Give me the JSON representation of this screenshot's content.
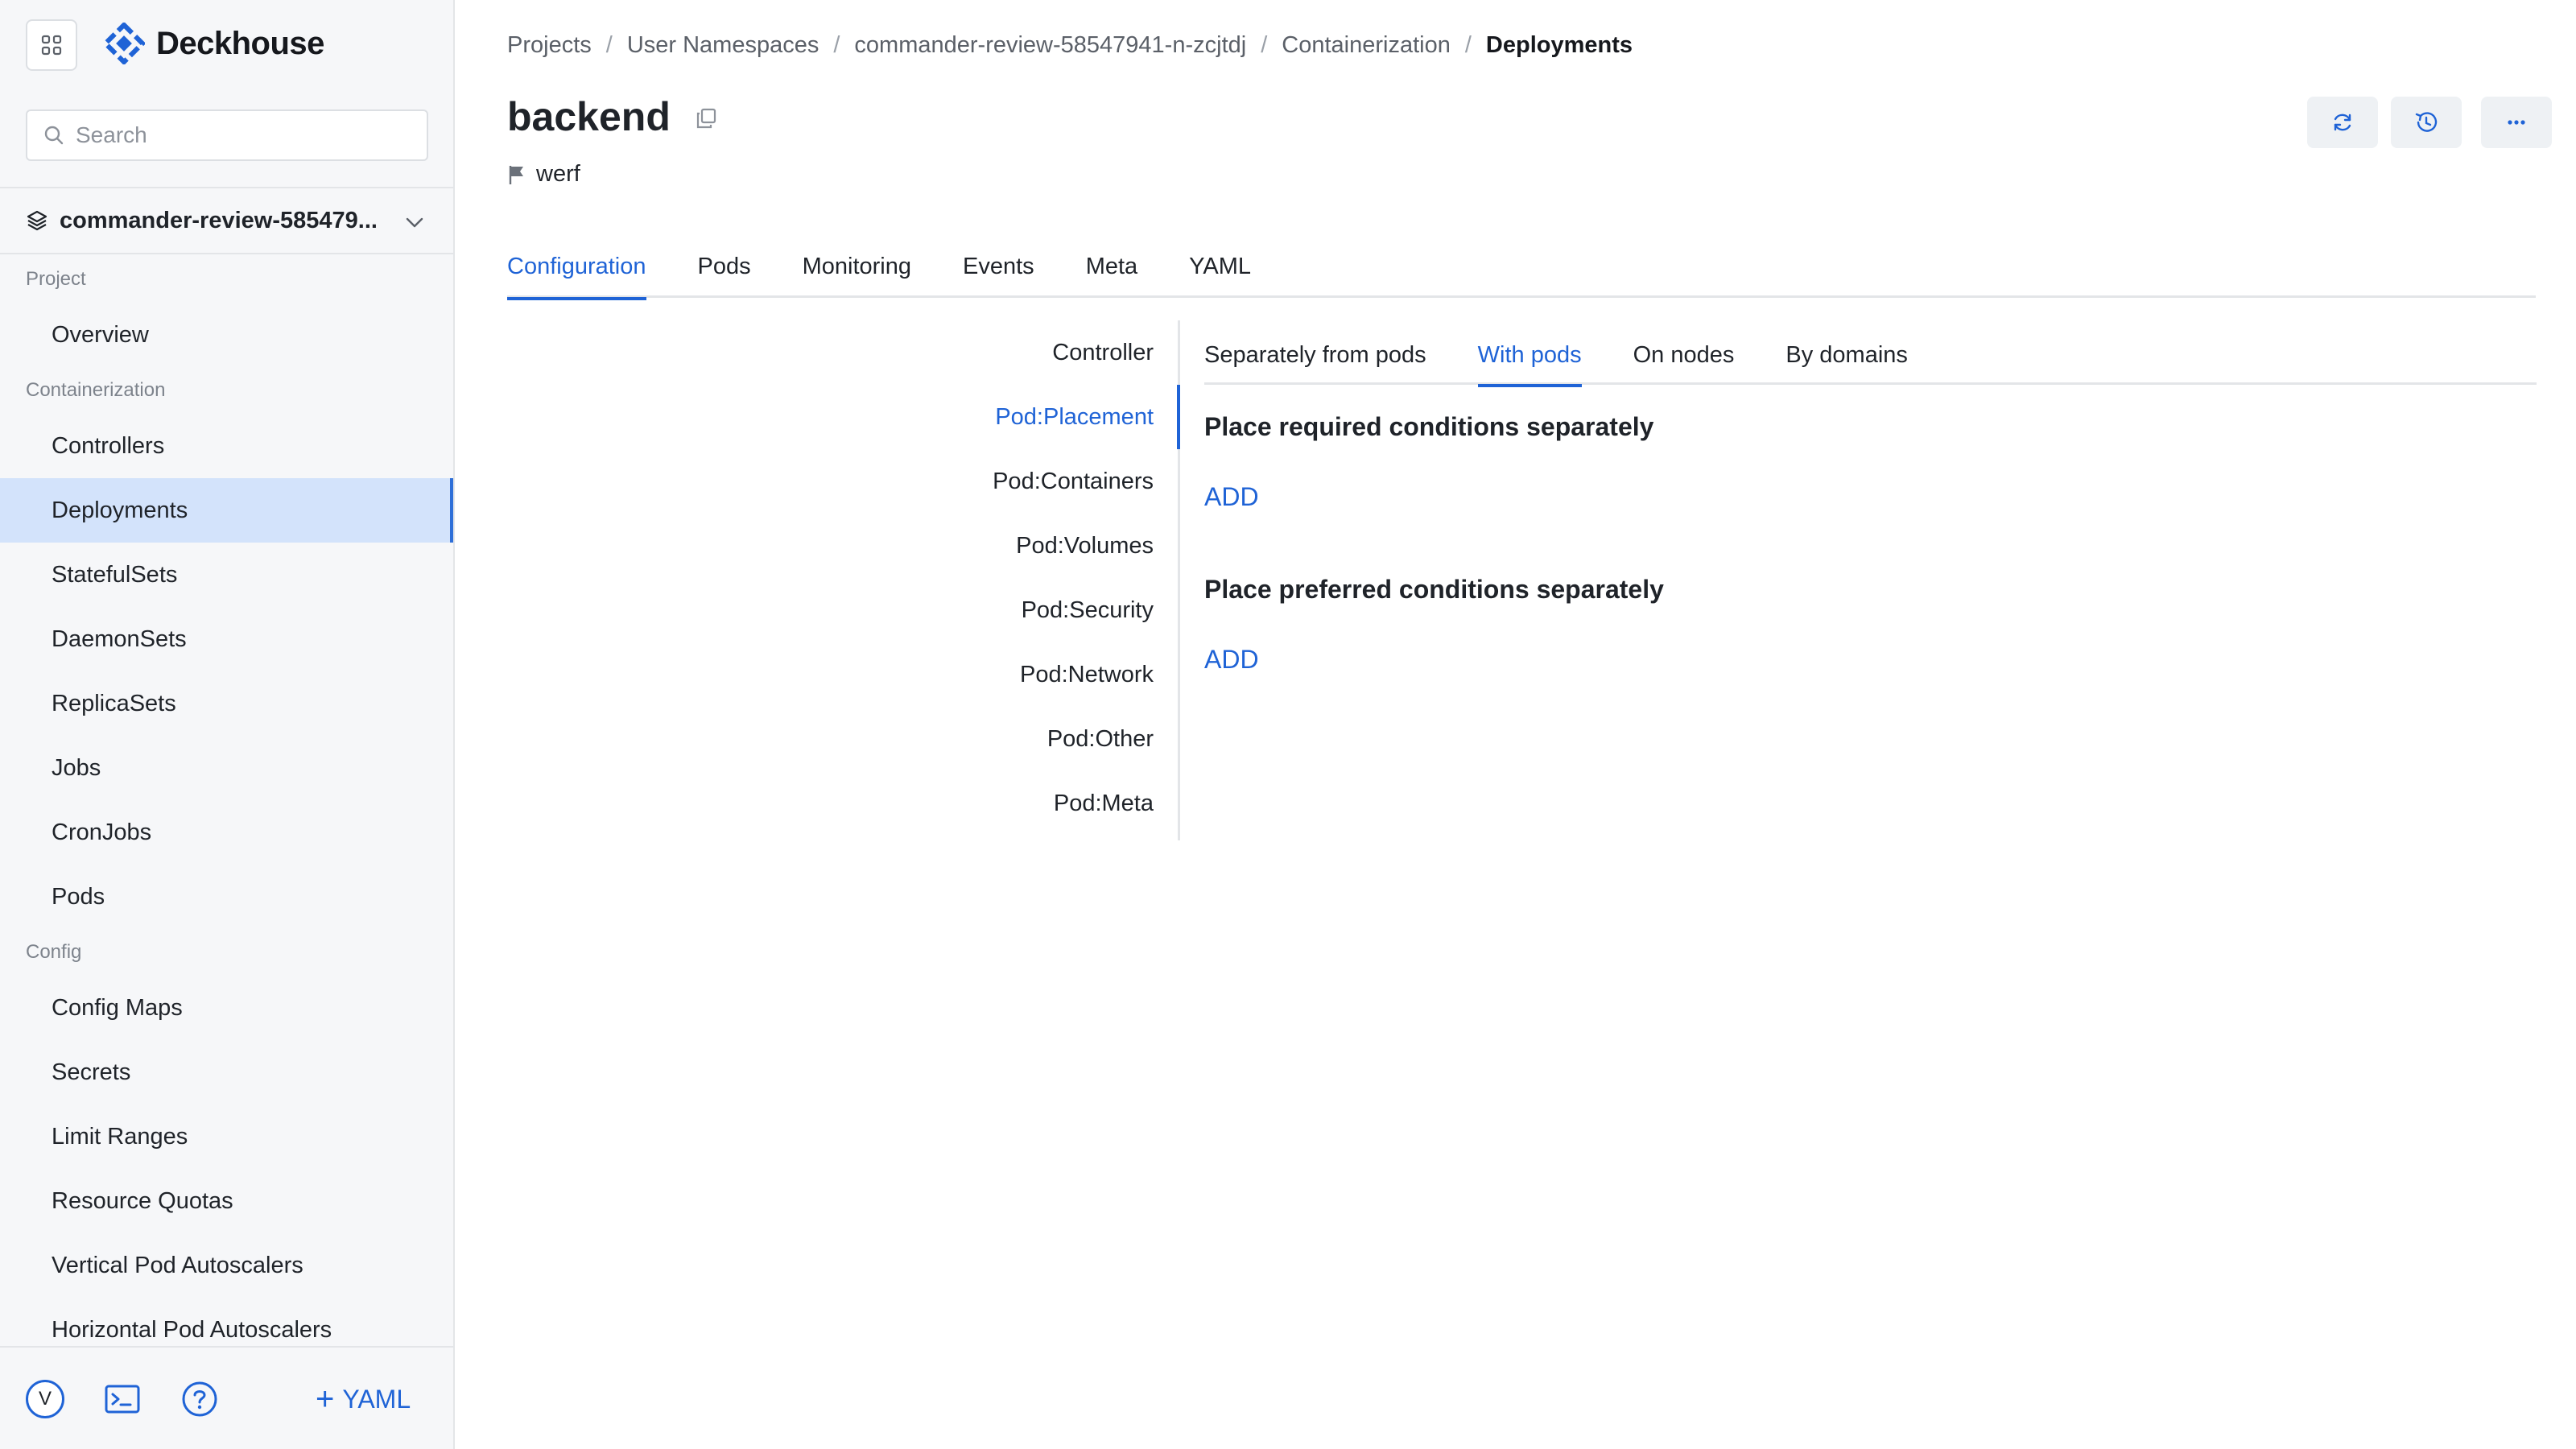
{
  "brand": {
    "name": "Deckhouse",
    "accent": "#1f63d6"
  },
  "search": {
    "placeholder": "Search"
  },
  "namespace": {
    "selected": "commander-review-585479..."
  },
  "sidebar": {
    "groups": [
      {
        "label": "Project",
        "items": [
          "Overview"
        ]
      },
      {
        "label": "Containerization",
        "items": [
          "Controllers",
          "Deployments",
          "StatefulSets",
          "DaemonSets",
          "ReplicaSets",
          "Jobs",
          "CronJobs",
          "Pods"
        ]
      },
      {
        "label": "Config",
        "items": [
          "Config Maps",
          "Secrets",
          "Limit Ranges",
          "Resource Quotas",
          "Vertical Pod Autoscalers",
          "Horizontal Pod Autoscalers"
        ]
      }
    ],
    "active_item": "Deployments"
  },
  "footer": {
    "avatar_letter": "V",
    "yaml_label": "YAML"
  },
  "breadcrumb": [
    "Projects",
    "User Namespaces",
    "commander-review-58547941-n-zcjtdj",
    "Containerization",
    "Deployments"
  ],
  "page": {
    "title": "backend",
    "owner": "werf"
  },
  "tabs": [
    "Configuration",
    "Pods",
    "Monitoring",
    "Events",
    "Meta",
    "YAML"
  ],
  "active_tab": "Configuration",
  "subnav": [
    "Controller",
    "Pod:Placement",
    "Pod:Containers",
    "Pod:Volumes",
    "Pod:Security",
    "Pod:Network",
    "Pod:Other",
    "Pod:Meta"
  ],
  "active_subnav": "Pod:Placement",
  "subtabs": [
    "Separately from pods",
    "With pods",
    "On nodes",
    "By domains"
  ],
  "active_subtab": "With pods",
  "sections": [
    {
      "title": "Place required conditions separately",
      "action": "ADD"
    },
    {
      "title": "Place preferred conditions separately",
      "action": "ADD"
    }
  ]
}
